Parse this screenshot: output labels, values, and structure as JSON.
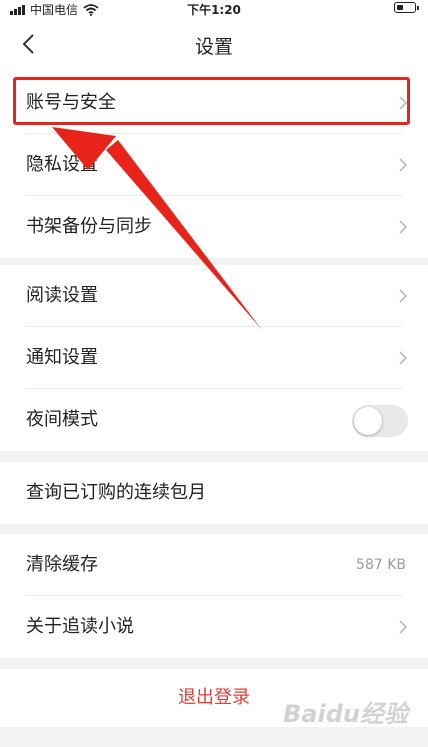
{
  "status_bar": {
    "carrier": "中国电信",
    "time": "下午1:20"
  },
  "nav": {
    "title": "设置"
  },
  "groups": [
    {
      "items": [
        {
          "label": "账号与安全"
        },
        {
          "label": "隐私设置"
        },
        {
          "label": "书架备份与同步"
        }
      ]
    },
    {
      "items": [
        {
          "label": "阅读设置"
        },
        {
          "label": "通知设置"
        },
        {
          "label": "夜间模式",
          "toggle_on": false
        }
      ]
    },
    {
      "items": [
        {
          "label": "查询已订购的连续包月"
        }
      ]
    },
    {
      "items": [
        {
          "label": "清除缓存",
          "value": "587 KB"
        },
        {
          "label": "关于追读小说"
        }
      ]
    }
  ],
  "logout_label": "退出登录",
  "icons": [
    "back-icon",
    "chevron-right-icon",
    "wifi-icon",
    "battery-icon",
    "signal-icon"
  ],
  "colors": {
    "logout": "#d9433a",
    "annotation": "#e8241a"
  },
  "watermark": "Baidu经验"
}
